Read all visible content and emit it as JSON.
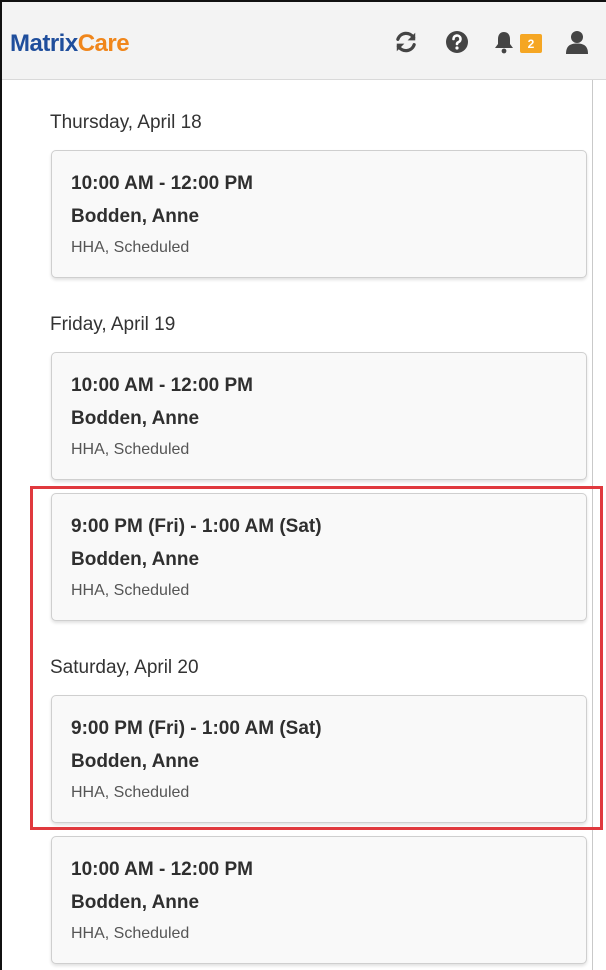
{
  "app": {
    "logo_part1": "Matrix",
    "logo_part2": "Care",
    "brand_blue": "#1f4e9c",
    "brand_orange": "#f0861b"
  },
  "header": {
    "icons": [
      "refresh-icon",
      "help-icon",
      "bell-icon",
      "user-icon"
    ],
    "notification_count": "2",
    "badge_color": "#f5a623"
  },
  "schedule": {
    "days": [
      {
        "label": "Thursday, April 18"
      },
      {
        "label": "Friday, April 19"
      },
      {
        "label": "Saturday, April 20"
      }
    ],
    "visits": [
      {
        "time": "10:00 AM - 12:00 PM",
        "name": "Bodden, Anne",
        "meta": "HHA, Scheduled"
      },
      {
        "time": "10:00 AM - 12:00 PM",
        "name": "Bodden, Anne",
        "meta": "HHA, Scheduled"
      },
      {
        "time": "9:00 PM (Fri) - 1:00 AM (Sat)",
        "name": "Bodden, Anne",
        "meta": "HHA, Scheduled"
      },
      {
        "time": "9:00 PM (Fri) - 1:00 AM (Sat)",
        "name": "Bodden, Anne",
        "meta": "HHA, Scheduled"
      },
      {
        "time": "10:00 AM - 12:00 PM",
        "name": "Bodden, Anne",
        "meta": "HHA, Scheduled"
      }
    ]
  },
  "annotation": {
    "highlight_color": "#e0393e"
  }
}
